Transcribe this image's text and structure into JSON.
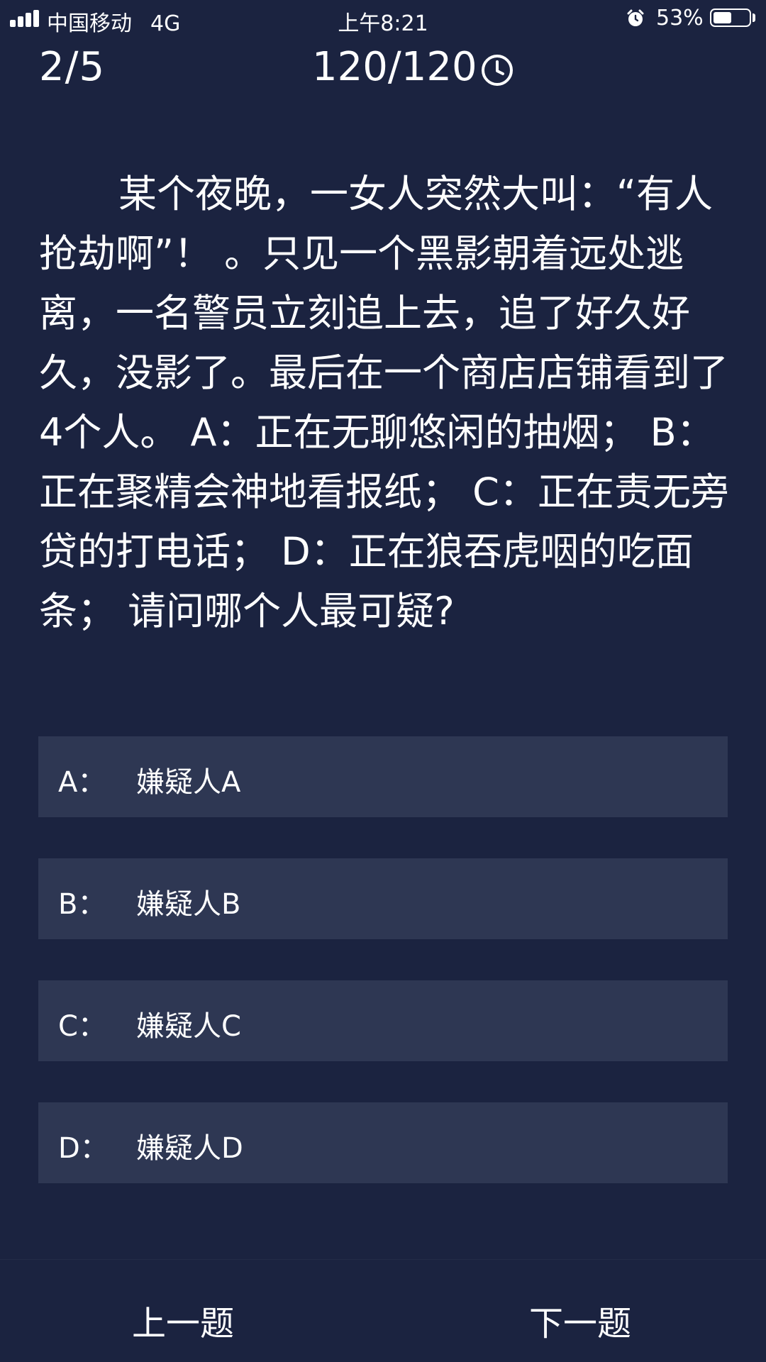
{
  "status_bar": {
    "carrier": "中国移动",
    "network": "4G",
    "time": "上午8:21",
    "battery_percent": "53%",
    "battery_level": 0.53,
    "icons": [
      "signal-icon",
      "alarm-icon",
      "battery-icon"
    ]
  },
  "header": {
    "progress": "2/5",
    "timer": "120/120",
    "timer_icon": "clock-icon"
  },
  "question": {
    "text": "某个夜晚，一女人突然大叫：“有人抢劫啊”！ 。只见一个黑影朝着远处逃离，一名警员立刻追上去，追了好久好久，没影了。最后在一个商店店铺看到了4个人。 A：正在无聊悠闲的抽烟； B：正在聚精会神地看报纸； C：正在责无旁贷的打电话； D：正在狼吞虎咽的吃面条； 请问哪个人最可疑?"
  },
  "options": [
    {
      "key": "A：",
      "text": "嫌疑人A"
    },
    {
      "key": "B：",
      "text": "嫌疑人B"
    },
    {
      "key": "C：",
      "text": "嫌疑人C"
    },
    {
      "key": "D：",
      "text": "嫌疑人D"
    }
  ],
  "nav": {
    "prev_label": "上一题",
    "next_label": "下一题"
  },
  "colors": {
    "background": "#1b2340",
    "option_background": "#2e3753",
    "text": "#ffffff"
  }
}
